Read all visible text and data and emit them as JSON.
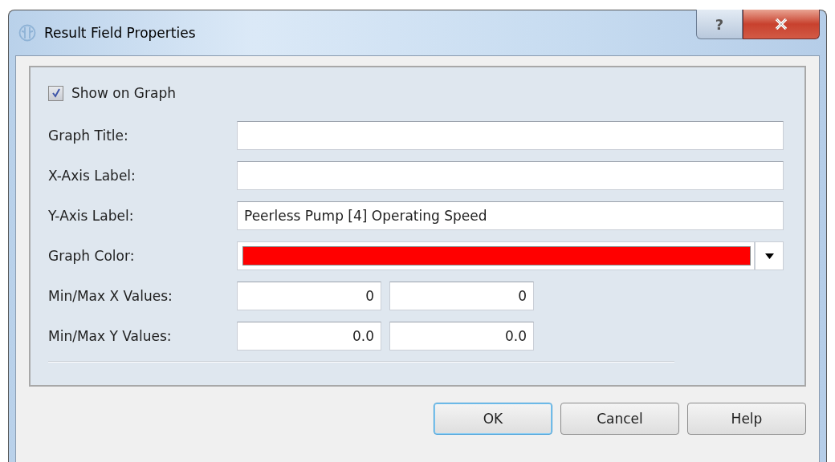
{
  "window": {
    "title": "Result Field Properties",
    "help_glyph": "?"
  },
  "show_on_graph": {
    "label": "Show on Graph",
    "checked": true
  },
  "fields": [
    {
      "kind": "text",
      "label": "Graph Title:"
    },
    {
      "kind": "text",
      "label": "X-Axis Label:"
    },
    {
      "kind": "text",
      "label": "Y-Axis Label:",
      "value": "Peerless Pump [4] Operating Speed"
    },
    {
      "kind": "color",
      "label": "Graph Color:",
      "color": "#ff0000"
    },
    {
      "kind": "pair",
      "label": "Min/Max X Values:",
      "values": [
        "0",
        "0"
      ]
    },
    {
      "kind": "pair",
      "label": "Min/Max Y Values:",
      "values": [
        "0.0",
        "0.0"
      ]
    }
  ],
  "buttons": [
    {
      "label": "OK",
      "selected": true
    },
    {
      "label": "Cancel",
      "selected": false
    },
    {
      "label": "Help",
      "selected": false
    }
  ]
}
